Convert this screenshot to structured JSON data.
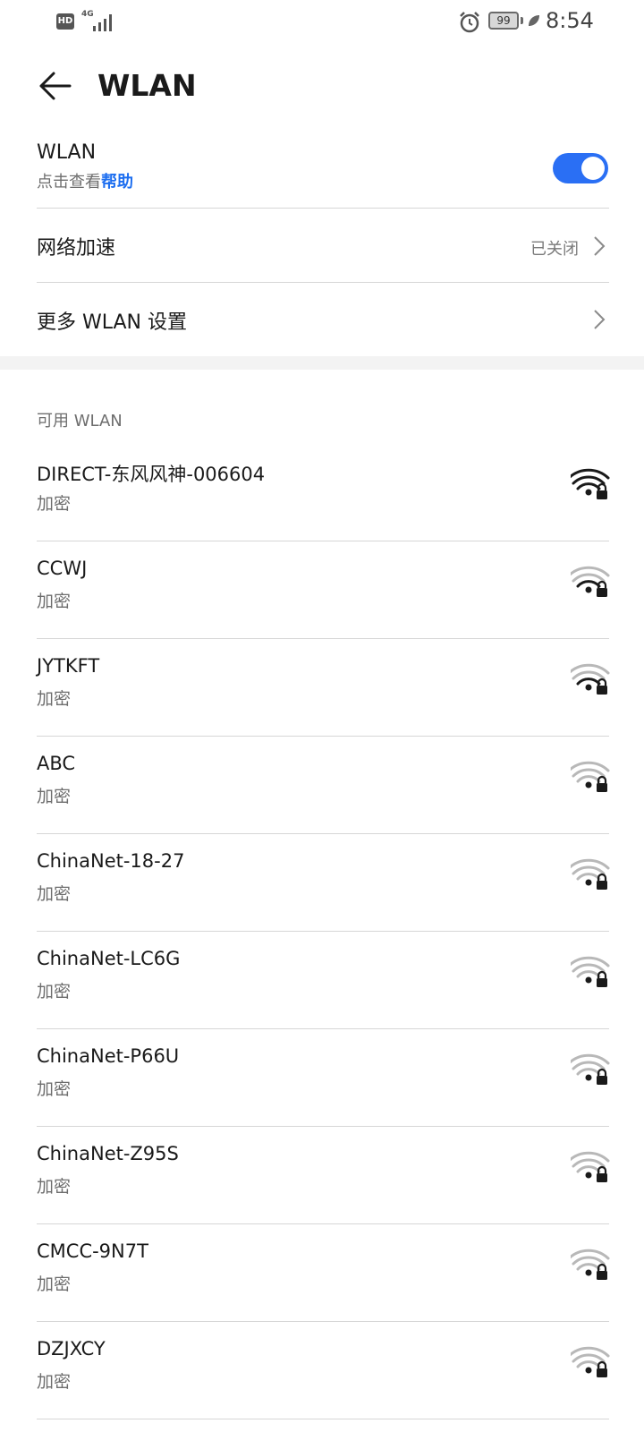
{
  "status_bar": {
    "hd": "HD",
    "network_type": "4G",
    "battery": "99",
    "time": "8:54"
  },
  "header": {
    "title": "WLAN"
  },
  "wlan_row": {
    "title": "WLAN",
    "subtitle_prefix": "点击查看",
    "help_link": "帮助",
    "toggle_state": "on"
  },
  "network_speedup": {
    "label": "网络加速",
    "status": "已关闭"
  },
  "more_settings": {
    "label": "更多 WLAN 设置"
  },
  "available": {
    "header": "可用 WLAN",
    "networks": [
      {
        "name": "DIRECT-东风风神-006604",
        "security": "加密",
        "signal": 4
      },
      {
        "name": "CCWJ",
        "security": "加密",
        "signal": 2
      },
      {
        "name": "JYTKFT",
        "security": "加密",
        "signal": 2
      },
      {
        "name": "ABC",
        "security": "加密",
        "signal": 1
      },
      {
        "name": "ChinaNet-18-27",
        "security": "加密",
        "signal": 1
      },
      {
        "name": "ChinaNet-LC6G",
        "security": "加密",
        "signal": 1
      },
      {
        "name": "ChinaNet-P66U",
        "security": "加密",
        "signal": 1
      },
      {
        "name": "ChinaNet-Z95S",
        "security": "加密",
        "signal": 1
      },
      {
        "name": "CMCC-9N7T",
        "security": "加密",
        "signal": 1
      },
      {
        "name": "DZJXCY",
        "security": "加密",
        "signal": 1
      }
    ]
  },
  "colors": {
    "accent": "#2a6ff4",
    "link": "#1e6ff0",
    "text_primary": "#1a1a1a",
    "text_secondary": "#6e6e6e"
  }
}
